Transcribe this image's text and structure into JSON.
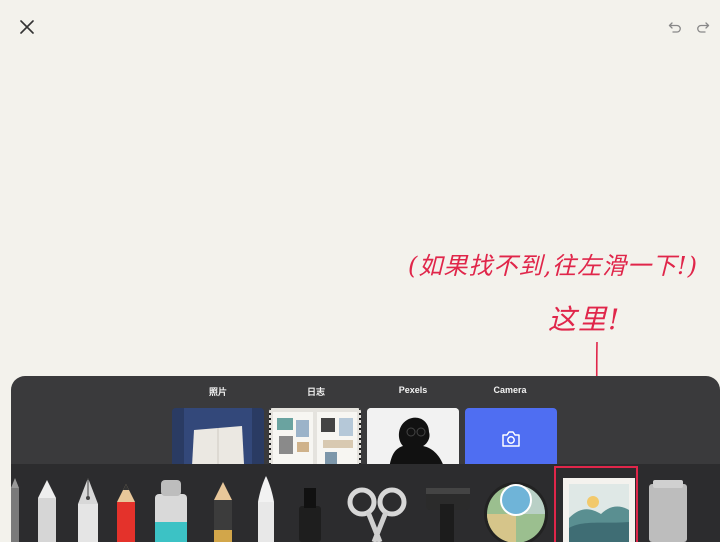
{
  "top_bar": {
    "close_icon": "close-icon",
    "undo_icon": "undo-icon",
    "redo_icon": "redo-icon"
  },
  "annotation": {
    "line1": "(如果找不到,往左滑一下!)",
    "line2": "这里!",
    "color": "#e0264a"
  },
  "tray": {
    "tabs": [
      {
        "label": "照片"
      },
      {
        "label": "日志"
      },
      {
        "label": "Pexels"
      },
      {
        "label": "Camera"
      }
    ],
    "camera_icon": "camera-icon",
    "tools": [
      "edge-tool",
      "eraser",
      "fountain-pen",
      "pencil",
      "marker",
      "pencil-2",
      "brush",
      "ink-bottle",
      "scissors",
      "tape-roller",
      "color-picker",
      "image-tool",
      "paper-tool"
    ]
  },
  "colors": {
    "background": "#f3f2ec",
    "tray": "#3a3a3c",
    "camera_tile": "#4f6ef2",
    "annotation": "#e0264a"
  }
}
